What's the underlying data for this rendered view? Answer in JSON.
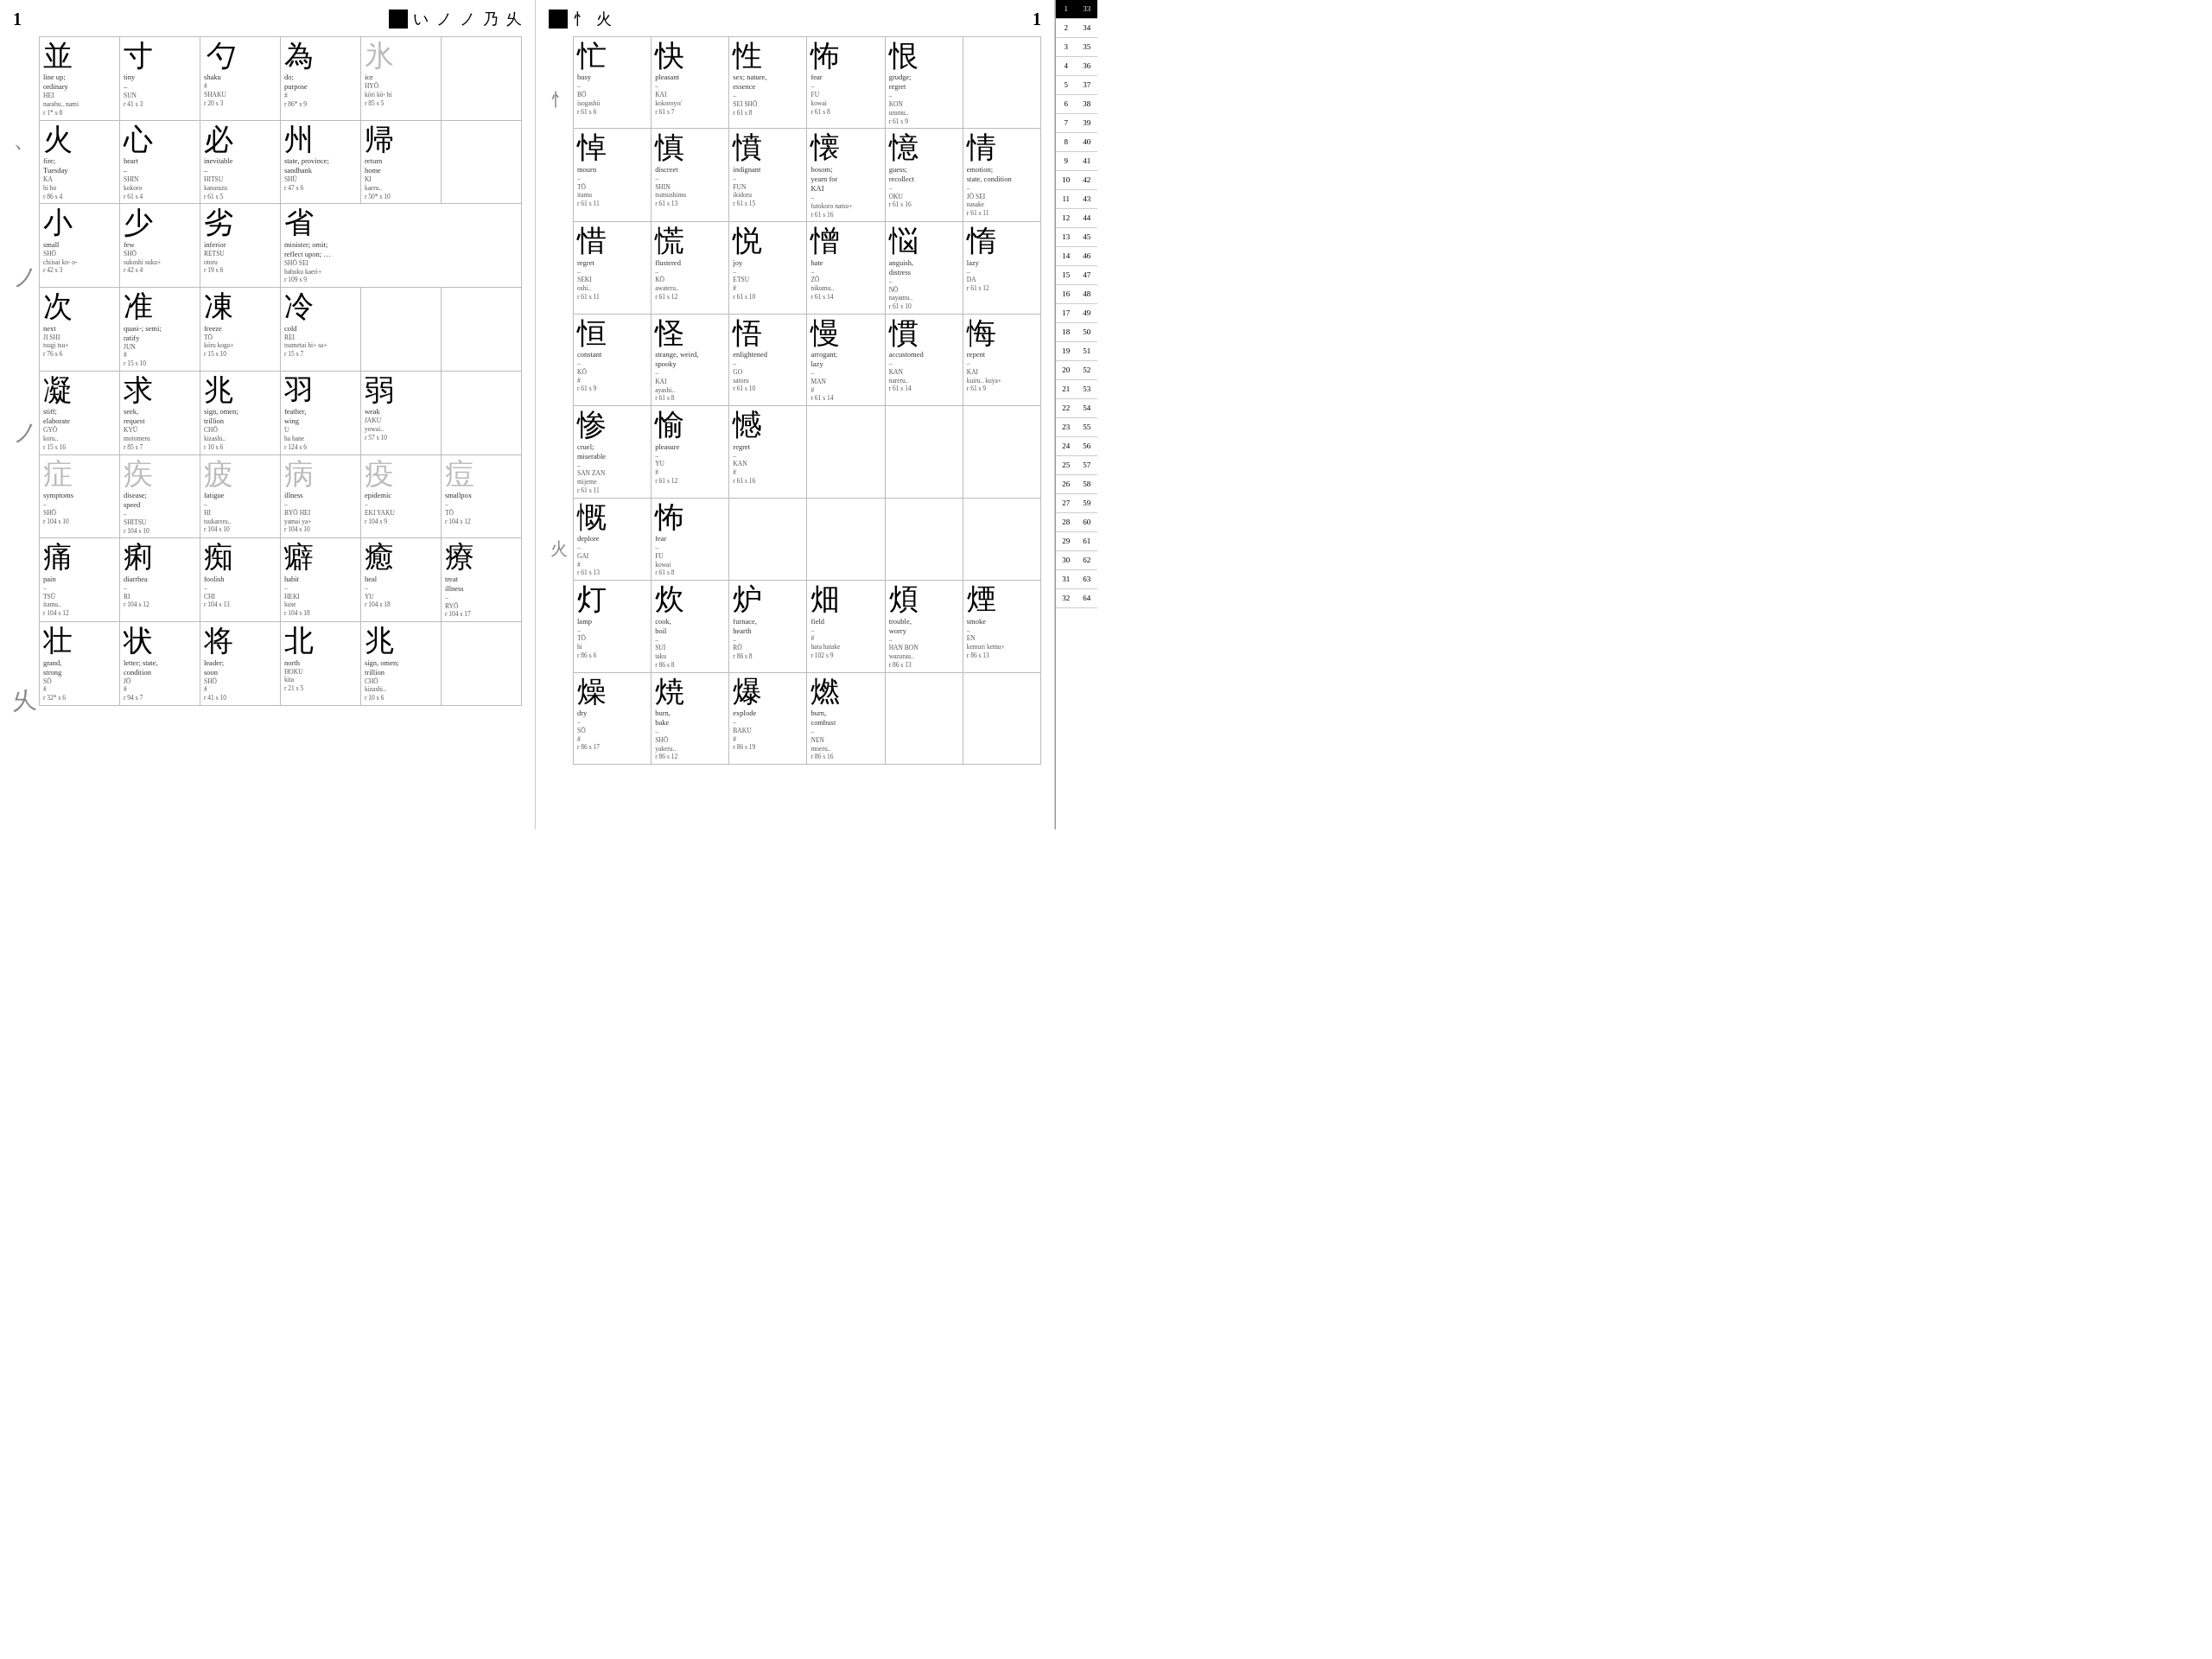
{
  "leftPage": {
    "pageNum": "1",
    "strokeIcons": "い ノ ノ 乃 乆",
    "rows": [
      [
        {
          "char": "並",
          "meaning": "line up; ordinary",
          "reading": "HEI\nnarabu.. nami\nr 1* s 8"
        },
        {
          "char": "寸",
          "meaning": "tiny\n–",
          "reading": "SUN\nr 41 s 3"
        },
        {
          "char": "勺",
          "meaning": "shaku",
          "reading": "#\nSHAKU\nr 20 s 3",
          "italic": true
        },
        {
          "char": "為",
          "meaning": "do; purpose",
          "reading": "#\nr 86* s 9"
        },
        {
          "char": "氷",
          "meaning": "ice",
          "reading": "HYŌ\nkōri kō- hi\nr 85 s 5",
          "gray": true
        }
      ],
      [
        {
          "char": "火",
          "meaning": "fire; Tuesday",
          "reading": "KA\nhi ho\nr 86 s 4"
        },
        {
          "char": "心",
          "meaning": "heart\n–",
          "reading": "SHIN\nkokoro\nr 61 s 4"
        },
        {
          "char": "必",
          "meaning": "inevitable\n–",
          "reading": "HITSU\nkanarazu\nr 61 s 5"
        },
        {
          "char": "州",
          "meaning": "state, province; sandbank",
          "reading": "SHŪ\nr 47 s 6"
        },
        {
          "char": "帰",
          "meaning": "return home",
          "reading": "KI\nkaeru..\nr 50* s 10"
        }
      ],
      [
        {
          "char": "小",
          "meaning": "small",
          "reading": "SHŌ\nchiisai ko- o-\nr 42 s 3"
        },
        {
          "char": "少",
          "meaning": "few",
          "reading": "SHŌ\nsukoshi suku+\nr 42 s 4"
        },
        {
          "char": "劣",
          "meaning": "inferior",
          "reading": "RETSU\notoru\nr 19 s 6"
        },
        {
          "char": "省",
          "meaning": "minister; omit; reflect upon; …",
          "reading": "SHŌ SEI\nhabuku kaeri+\nr 109 s 9"
        }
      ],
      [
        {
          "char": "次",
          "meaning": "next",
          "reading": "JI SHI\ntsugi tsu+\nr 76 s 6"
        },
        {
          "char": "准",
          "meaning": "quasi-; semi; ratify",
          "reading": "JUN\nr 15 s 10"
        },
        {
          "char": "凍",
          "meaning": "freeze",
          "reading": "TŌ\nkōru kogo+\nr 15 s 10"
        },
        {
          "char": "冷",
          "meaning": "cold",
          "reading": "REI\ntsumetai hi+ sa+\nr 15 s 7"
        }
      ],
      [
        {
          "char": "凝",
          "meaning": "stiff; elaborate",
          "reading": "GYŌ\nkoru..\nr 15 s 16"
        },
        {
          "char": "求",
          "meaning": "seek, request",
          "reading": "KYŪ\nmotomeru\nr 85 s 7"
        },
        {
          "char": "兆",
          "meaning": "sign, omen; trillion",
          "reading": "CHŌ\nkizashi..\nr 10 s 6"
        },
        {
          "char": "羽",
          "meaning": "feather, wing",
          "reading": "U\nha hane\nr 124 s 6"
        },
        {
          "char": "弱",
          "meaning": "weak",
          "reading": "JAKU\nyowai..\nr 57 s 10"
        }
      ],
      [
        {
          "char": "症",
          "meaning": "symptoms",
          "reading": "–\nSHŌ\nr 104 s 10",
          "gray": true
        },
        {
          "char": "疾",
          "meaning": "disease; speed",
          "reading": "–\nSHITSU\nr 104 s 10",
          "gray": true
        },
        {
          "char": "疲",
          "meaning": "fatigue",
          "reading": "–\nHI\ntsukareru..\nr 104 s 10",
          "gray": true
        },
        {
          "char": "病",
          "meaning": "illness",
          "reading": "–\nBYŌ HEI\nyamai ya+\nr 104 s 10",
          "gray": true
        },
        {
          "char": "疫",
          "meaning": "epidemic",
          "reading": "–\nEKI YAKU\nr 104 s 9",
          "gray": true
        },
        {
          "char": "痘",
          "meaning": "smallpox",
          "reading": "–\nTŌ\nr 104 s 12",
          "gray": true
        }
      ],
      [
        {
          "char": "痛",
          "meaning": "pain",
          "reading": "–\nTSŪ\nitamu..\nr 104 s 12"
        },
        {
          "char": "痢",
          "meaning": "diarrhea",
          "reading": "–\nRI\nr 104 s 12"
        },
        {
          "char": "痴",
          "meaning": "foolish",
          "reading": "–\nCHI\nr 104 s 13"
        },
        {
          "char": "癖",
          "meaning": "habit",
          "reading": "–\nHEKI\nkuse\nr 104 s 18"
        },
        {
          "char": "癒",
          "meaning": "heal",
          "reading": "–\nYU\nr 104 s 18"
        },
        {
          "char": "療",
          "meaning": "treat illness",
          "reading": "–\nRYŌ\nr 104 s 17"
        }
      ],
      [
        {
          "char": "壮",
          "meaning": "grand, strong",
          "reading": "SŌ\nr 32* s 6"
        },
        {
          "char": "状",
          "meaning": "letter; state, condition",
          "reading": "JŌ\nr 94 s 7"
        },
        {
          "char": "将",
          "meaning": "leader; soon",
          "reading": "SHŌ\nr 41 s 10"
        },
        {
          "char": "北",
          "meaning": "north",
          "reading": "HOKU\nkita\nr 21 s 5"
        },
        {
          "char": "兆",
          "meaning": "sign, omen; trillion",
          "reading": "CHŌ\nkizashi..\nr 10 s 6"
        }
      ]
    ]
  },
  "rightPage": {
    "pageNum": "1",
    "strokeIcons": "忄 火",
    "rows": [
      [
        {
          "char": "忙",
          "meaning": "busy",
          "reading": "–\nBŌ\nisogashii\nr 61 s 6"
        },
        {
          "char": "快",
          "meaning": "pleasant",
          "reading": "–\nKAI\nkokoroyo/\nr 61 s 7"
        },
        {
          "char": "性",
          "meaning": "sex; nature, essence",
          "reading": "–\nSEI SHŌ\nr 61 s 8"
        },
        {
          "char": "怖",
          "meaning": "fear",
          "reading": "–\nFU\nkowai\nr 61 s 8"
        },
        {
          "char": "恨",
          "meaning": "grudge; regret",
          "reading": "–\nKON\nuramu..\nr 61 s 9"
        }
      ],
      [
        {
          "char": "悼",
          "meaning": "mourn",
          "reading": "–\nTŌ\nitamu\nr 61 s 11"
        },
        {
          "char": "慎",
          "meaning": "discreet",
          "reading": "–\nSHIN\ntsutsushimu\nr 61 s 13"
        },
        {
          "char": "憤",
          "meaning": "indignant",
          "reading": "–\nFUN\nikidoru\nr 61 s 15"
        },
        {
          "char": "懐",
          "meaning": "bosom; yearn for",
          "reading": "–\nKAI\nfutokoro natsu+\nr 61 s 16"
        },
        {
          "char": "憶",
          "meaning": "guess; recollect",
          "reading": "–\nOKU\nr 61 s 16"
        },
        {
          "char": "情",
          "meaning": "emotion; state, condition",
          "reading": "–\nJŌ SEI\nnasake\nr 61 s 11"
        }
      ],
      [
        {
          "char": "惜",
          "meaning": "regret",
          "reading": "–\nSEKI\noshi..\nr 61 s 11"
        },
        {
          "char": "慌",
          "meaning": "flustered",
          "reading": "–\nKŌ\nawateru..\nr 61 s 12"
        },
        {
          "char": "悦",
          "meaning": "joy",
          "reading": "–\nETSU\nr 61 s 10"
        },
        {
          "char": "憎",
          "meaning": "hate",
          "reading": "–\nZŌ\nnikumu..\nr 61 s 14"
        },
        {
          "char": "悩",
          "meaning": "anguish, distress",
          "reading": "–\nNŌ\nnayamu..\nr 61 s 10"
        },
        {
          "char": "惰",
          "meaning": "lazy",
          "reading": "–\nDA\nr 61 s 12"
        }
      ],
      [
        {
          "char": "恒",
          "meaning": "constant",
          "reading": "–\nKŌ\nr 61 s 9"
        },
        {
          "char": "怪",
          "meaning": "strange, weird, spooky",
          "reading": "–\nKAI\nayashi..\nr 61 s 8"
        },
        {
          "char": "悟",
          "meaning": "enlightened",
          "reading": "–\nGO\nsatoru\nr 61 s 10"
        },
        {
          "char": "慢",
          "meaning": "arrogant; lazy",
          "reading": "–\nMAN\nr 61 s 14"
        },
        {
          "char": "慣",
          "meaning": "accustomed",
          "reading": "–\nKAN\nnareru..\nr 61 s 14"
        },
        {
          "char": "悔",
          "meaning": "repent",
          "reading": "–\nKAI\nkuiru.. kuya+\nr 61 s 9"
        }
      ],
      [
        {
          "char": "惨",
          "meaning": "cruel; miserable",
          "reading": "–\nSAN ZAN\nmijeme\nr 61 s 11"
        },
        {
          "char": "愉",
          "meaning": "pleasure",
          "reading": "–\nYU\nr 61 s 12"
        },
        {
          "char": "憾",
          "meaning": "regret",
          "reading": "–\nKAN\nr 61 s 16"
        }
      ],
      [
        {
          "char": "慨",
          "meaning": "deplore",
          "reading": "–\nGAI\nr 61 s 13"
        },
        {
          "char": "怖",
          "meaning": "fear",
          "reading": "–\nFU\nkowai\nr 61 s 8"
        }
      ],
      [
        {
          "char": "灯",
          "meaning": "lamp",
          "reading": "–\nTŌ\nhi\nr 86 s 6"
        },
        {
          "char": "炊",
          "meaning": "cook, boil",
          "reading": "–\nSUI\ntaku\nr 86 s 8"
        },
        {
          "char": "炉",
          "meaning": "furnace, hearth",
          "reading": "–\nRŌ\nr 86 s 8"
        },
        {
          "char": "畑",
          "meaning": "field",
          "reading": "–\n#\nhata hatake\nr 102 s 9"
        },
        {
          "char": "煩",
          "meaning": "trouble, worry",
          "reading": "–\nHAN BON\nwazurau..\nr 86 s 13"
        },
        {
          "char": "煙",
          "meaning": "smoke",
          "reading": "–\nEN\nkemuri kemu+\nr 86 s 13"
        }
      ],
      [
        {
          "char": "燥",
          "meaning": "dry",
          "reading": "–\nSŌ\nr 86 s 17"
        },
        {
          "char": "焼",
          "meaning": "burn, bake",
          "reading": "–\nSHŌ\nyakeru..\nr 86 s 12"
        },
        {
          "char": "爆",
          "meaning": "explode",
          "reading": "–\nBAKU\nr 86 s 19"
        },
        {
          "char": "燃",
          "meaning": "burn, combust",
          "reading": "–\nNEN\nmoeru..\nr 86 s 16"
        }
      ]
    ]
  },
  "indexNums": {
    "left": [
      "1",
      "2",
      "3",
      "4",
      "5",
      "6",
      "7",
      "8",
      "9",
      "10",
      "11",
      "12",
      "13",
      "14",
      "15",
      "16",
      "17",
      "18",
      "19",
      "20",
      "21",
      "22",
      "23",
      "24",
      "25",
      "26",
      "27",
      "28",
      "29",
      "30",
      "31",
      "32"
    ],
    "right": [
      "33",
      "34",
      "35",
      "36",
      "37",
      "38",
      "39",
      "40",
      "41",
      "42",
      "43",
      "44",
      "45",
      "46",
      "47",
      "48",
      "49",
      "50",
      "51",
      "52",
      "53",
      "54",
      "55",
      "56",
      "57",
      "58",
      "59",
      "60",
      "61",
      "62",
      "63",
      "64"
    ]
  }
}
